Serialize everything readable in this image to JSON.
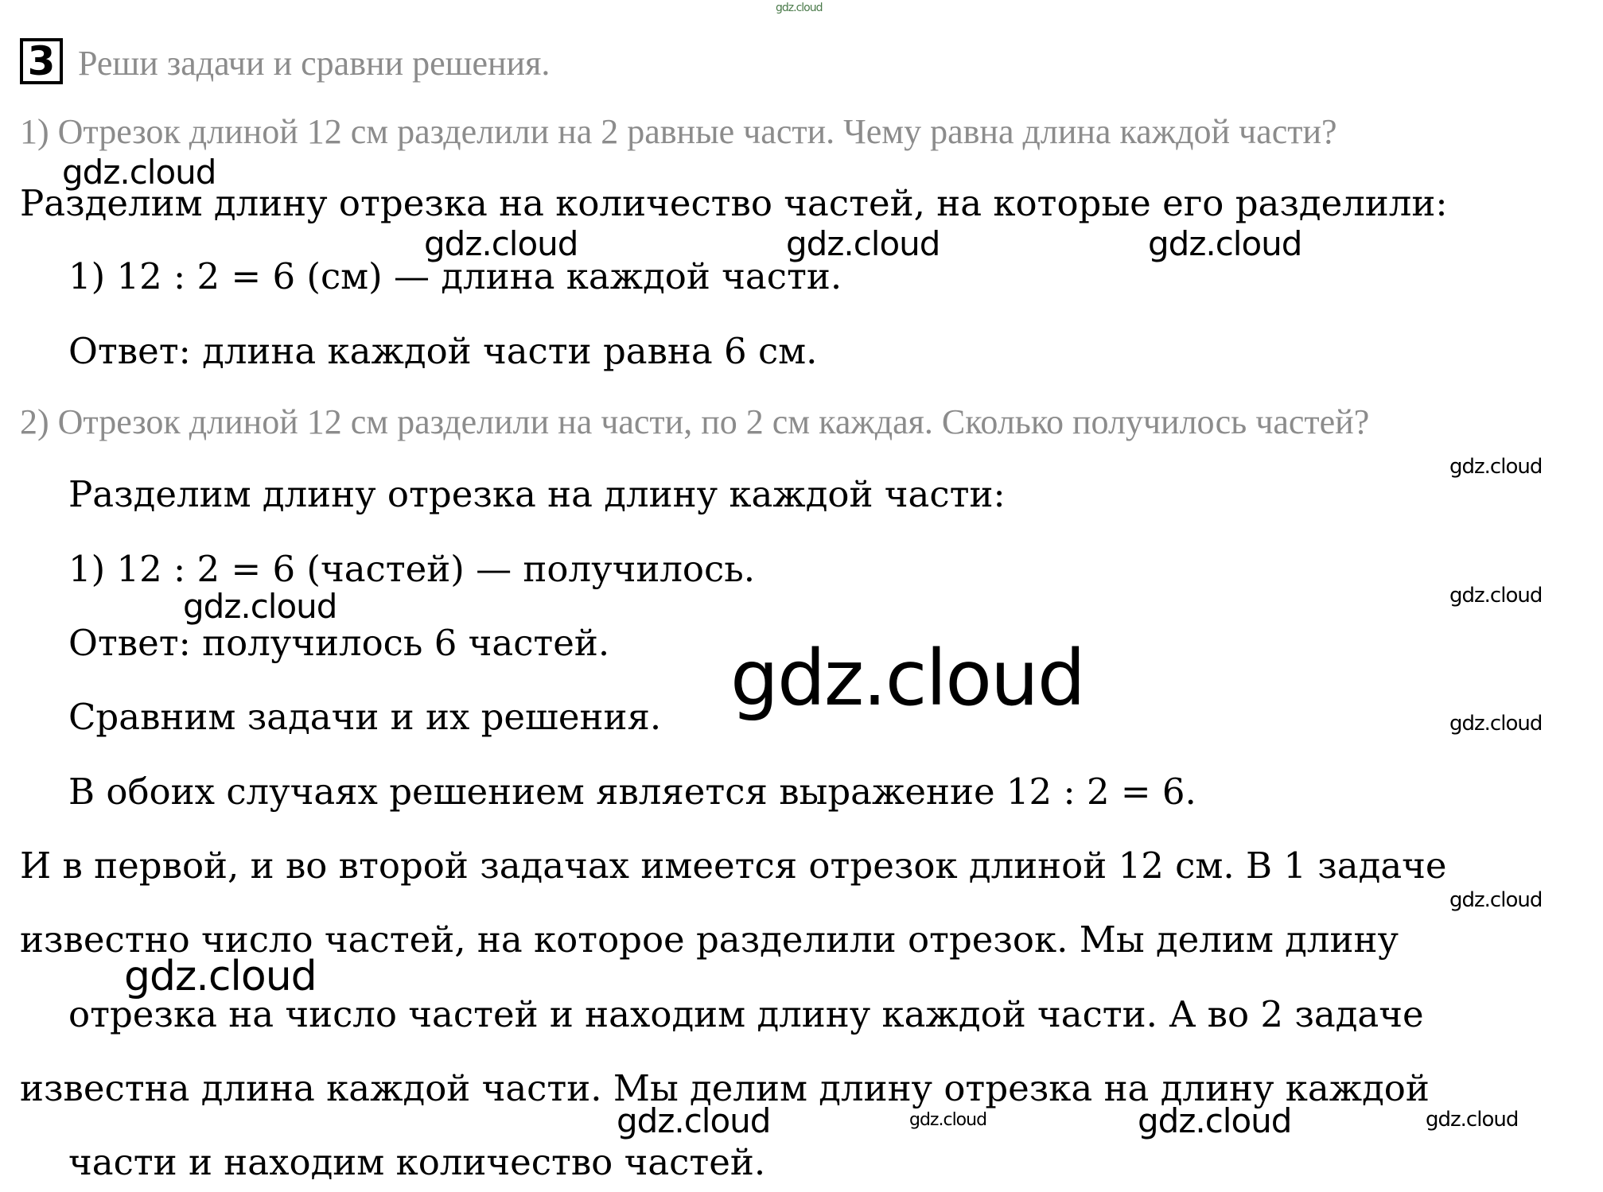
{
  "header": {
    "task_number": "3",
    "task_title": "Реши задачи и сравни решения."
  },
  "problem1": {
    "question": "1) Отрезок длиной 12 см разделили на 2 равные части. Чему равна длина каждой части?",
    "intro": "Разделим длину отрезка на количество частей, на которые его разделили:",
    "step": "1) 12 : 2 = 6 (см) — длина каждой части.",
    "answer": "Ответ: длина каждой части равна 6 см."
  },
  "problem2": {
    "question": "2) Отрезок длиной 12 см разделили на части, по 2 см каждая. Сколько получилось частей?",
    "intro": "Разделим длину отрезка на длину каждой части:",
    "step": "1) 12 : 2 = 6 (частей) — получилось.",
    "answer": "Ответ: получилось 6 частей."
  },
  "comparison": {
    "line1": "Сравним задачи и их решения.",
    "line2": "В обоих случаях решением является выражение 12 : 2 = 6.",
    "line3": "И в первой, и во второй задачах имеется отрезок длиной 12 см. В 1 задаче",
    "line4": "известно число частей, на которое разделили отрезок. Мы делим длину",
    "line5": "отрезка на число частей и находим длину каждой части. А во 2 задаче",
    "line6": "известна длина каждой части. Мы делим длину отрезка на длину каждой",
    "line7": "части и находим количество частей."
  },
  "watermark": {
    "text": "gdz.cloud"
  }
}
